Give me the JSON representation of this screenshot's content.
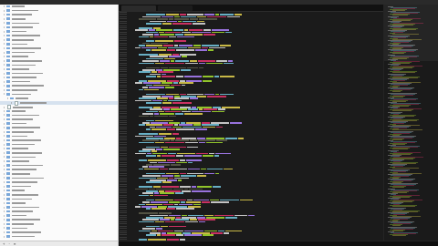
{
  "window": {
    "title": ""
  },
  "editor": {
    "active_tab": "",
    "secondary_tab": ""
  },
  "colors": {
    "keyword": "#e8356e",
    "string": "#e6d44e",
    "function": "#76c9e2",
    "variable": "#a6e22e",
    "plain": "#e0e0e0",
    "comment": "#5c5c4a",
    "number": "#ae81ff",
    "sidebar_bg": "#fbfbfb",
    "editor_bg": "#1b1b1b",
    "selection": "#d6e2ef"
  },
  "sidebar": {
    "tree_rows": 56,
    "selected_row": 23,
    "tools": [
      "+",
      "-",
      "≡"
    ]
  },
  "status": {
    "left": "",
    "right": ""
  }
}
